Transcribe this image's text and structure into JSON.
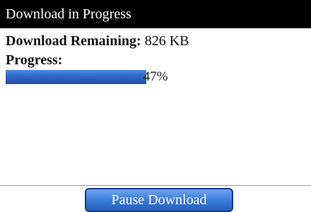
{
  "title": "Download in Progress",
  "download": {
    "remaining_label": "Download Remaining:",
    "remaining_value": "826 KB",
    "progress_label": "Progress:",
    "progress_percent": 47,
    "progress_text": "47%"
  },
  "actions": {
    "pause_label": "Pause Download"
  },
  "colors": {
    "titlebar_bg": "#000000",
    "progress_fill": "#2f66c6",
    "button_bg": "#3f7fda"
  }
}
